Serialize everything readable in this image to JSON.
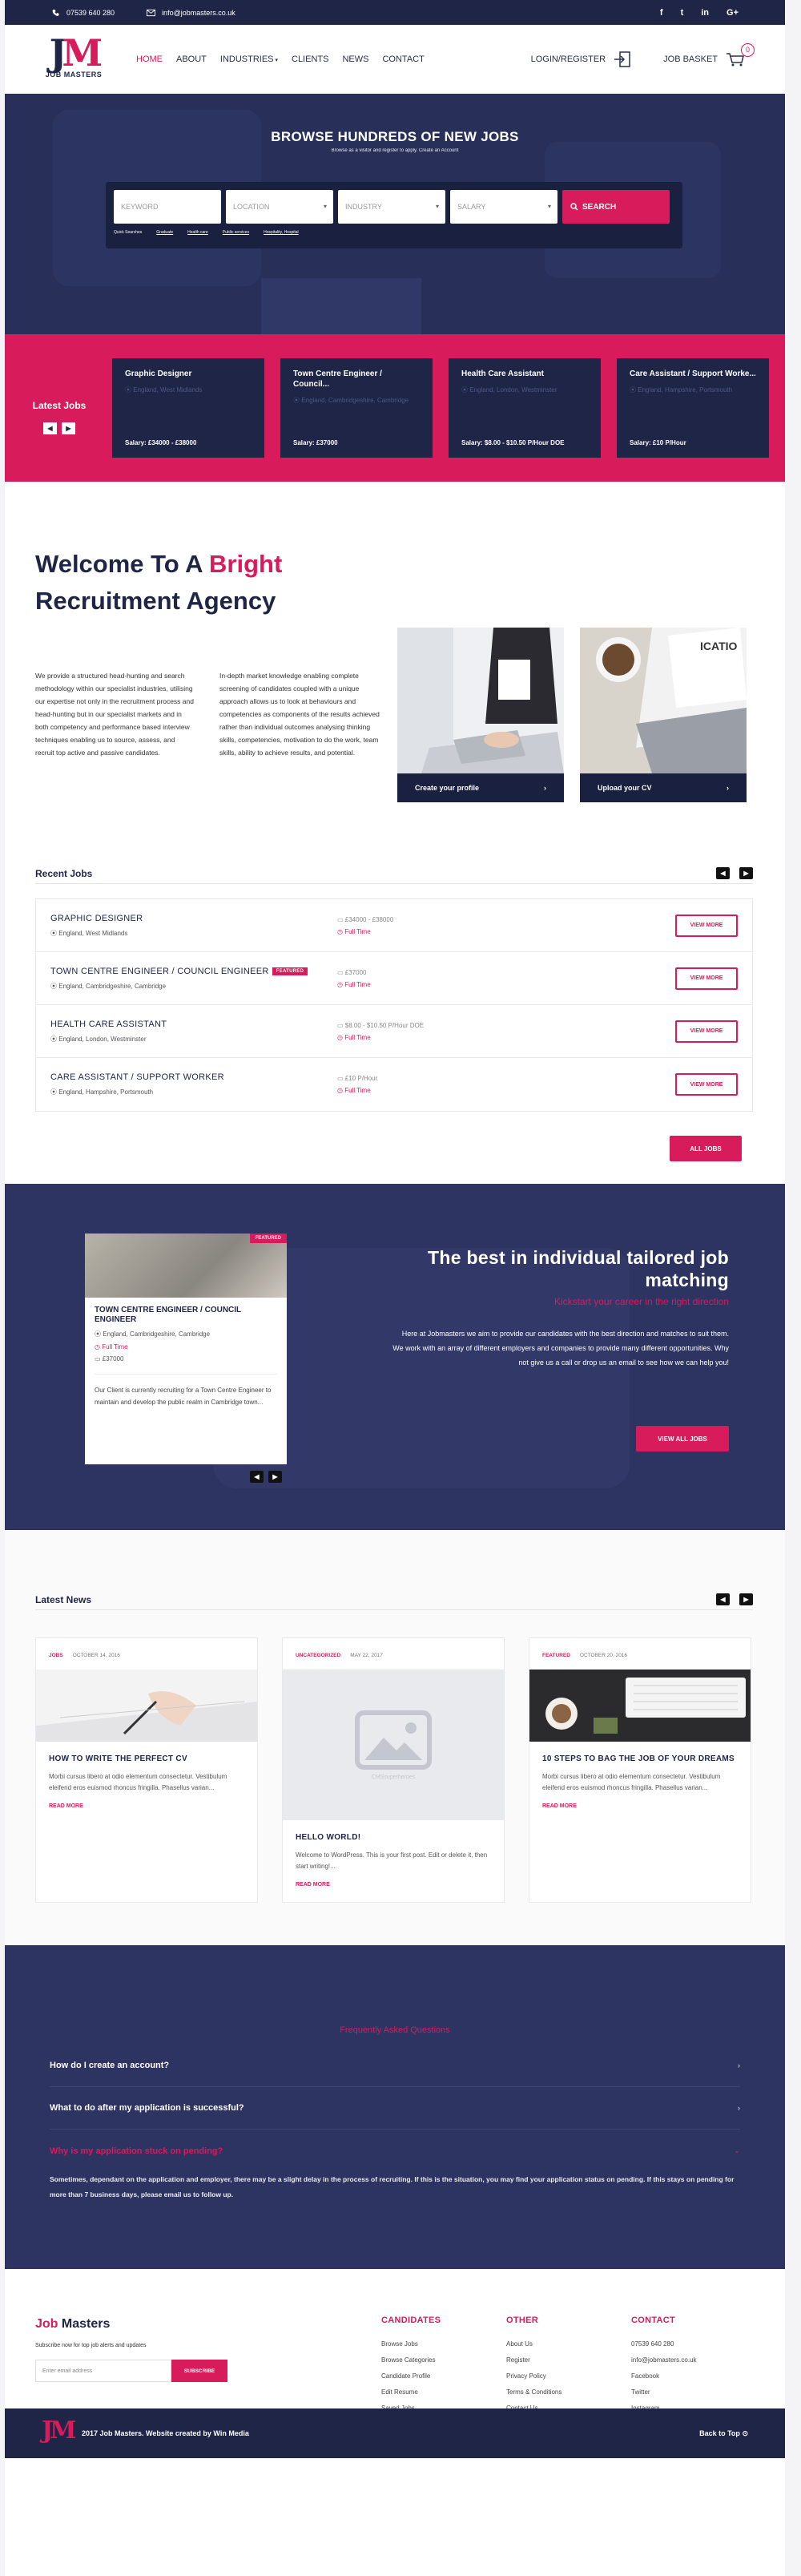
{
  "topbar": {
    "phone": "07539 640 280",
    "email": "info@jobmasters.co.uk",
    "social": [
      "f",
      "t",
      "in",
      "G+"
    ]
  },
  "brand": {
    "mark_j": "J",
    "mark_m": "M",
    "name": "JOB MASTERS"
  },
  "nav": {
    "items": [
      "HOME",
      "ABOUT",
      "INDUSTRIES",
      "CLIENTS",
      "NEWS",
      "CONTACT"
    ],
    "login": "LOGIN/REGISTER",
    "basket": "JOB BASKET",
    "basket_count": "0"
  },
  "hero": {
    "title": "BROWSE HUNDREDS OF NEW JOBS",
    "subtitle": "Browse as a visitor and register to apply. Create an Account",
    "fields": {
      "keyword": "KEYWORD",
      "location": "LOCATION",
      "industry": "INDUSTRY",
      "salary": "SALARY"
    },
    "search_label": "SEARCH",
    "quick": [
      "Quick Searches",
      "Graduate",
      "Health care",
      "Public services",
      "Hospitality, Hospital"
    ]
  },
  "latest_jobs": {
    "label": "Latest Jobs",
    "cards": [
      {
        "title": "Graphic Designer",
        "location": "England, West Midlands",
        "salary": "Salary: £34000 - £38000"
      },
      {
        "title": "Town Centre Engineer / Council...",
        "location": "England, Cambridgeshire, Cambridge",
        "salary": "Salary: £37000"
      },
      {
        "title": "Health Care Assistant",
        "location": "England, London, Westminster",
        "salary": "Salary: $8.00 - $10.50 P/Hour DOE"
      },
      {
        "title": "Care Assistant / Support Worke...",
        "location": "England, Hampshire, Portsmouth",
        "salary": "Salary: £10 P/Hour"
      }
    ]
  },
  "welcome": {
    "line1": "Welcome To A ",
    "bright": "Bright",
    "line2": "Recruitment Agency",
    "p1": "We provide a structured head-hunting and search methodology within our specialist industries, utilising our expertise not only in the recruitment process and head-hunting but in our specialist markets and in both competency and performance based interview techniques enabling us to source, assess, and recruit top active and passive candidates.",
    "p2": "In-depth market knowledge enabling complete screening of candidates coupled with a unique approach allows us to look at behaviours and competencies as components of the results achieved rather than individual outcomes analysing thinking skills, competencies, motivation to do the work, team skills, ability to achieve results, and potential.",
    "cards": [
      {
        "label": "Create your profile"
      },
      {
        "label": "Upload your CV"
      }
    ]
  },
  "recent": {
    "title": "Recent Jobs",
    "view_more": "VIEW MORE",
    "all_jobs": "ALL JOBS",
    "featured": "FEATURED",
    "jobs": [
      {
        "title": "GRAPHIC DESIGNER",
        "location": "England, West Midlands",
        "salary": "£34000 - £38000",
        "type": "Full Time"
      },
      {
        "title": "TOWN CENTRE ENGINEER / COUNCIL ENGINEER",
        "location": "England, Cambridgeshire, Cambridge",
        "salary": "£37000",
        "type": "Full Time"
      },
      {
        "title": "HEALTH CARE ASSISTANT",
        "location": "England, London, Westminster",
        "salary": "$8.00 - $10.50 P/Hour DOE",
        "type": "Full Time"
      },
      {
        "title": "CARE ASSISTANT / SUPPORT WORKER",
        "location": "England, Hampshire, Portsmouth",
        "salary": "£10 P/Hour",
        "type": "Full Time"
      }
    ]
  },
  "tailored": {
    "card": {
      "badge": "FEATURED",
      "title": "TOWN CENTRE ENGINEER / COUNCIL ENGINEER",
      "location": "England, Cambridgeshire, Cambridge",
      "type": "Full Time",
      "salary": "£37000",
      "desc": "Our Client is currently recruiting for a Town Centre Engineer to maintain and develop the public realm in Cambridge town..."
    },
    "title": "The best in individual tailored job matching",
    "subtitle": "Kickstart your career in the right direction",
    "body": "Here at Jobmasters we aim to provide our candidates with the best direction and matches to suit them. We work with an array of different employers and companies to provide many different opportunities. Why not give us a call or drop us an email to see how we can help you!",
    "cta": "VIEW ALL JOBS"
  },
  "news": {
    "title": "Latest News",
    "read_more": "READ MORE",
    "items": [
      {
        "cat": "JOBS",
        "date": "OCTOBER 14, 2016",
        "title": "HOW TO WRITE THE PERFECT CV",
        "excerpt": "Morbi cursus libero at odio elementum consectetur. Vestibulum eleifend eros euismod rhoncus fringilla. Phasellus varian..."
      },
      {
        "cat": "UNCATEGORIZED",
        "date": "MAY 22, 2017",
        "title": "HELLO WORLD!",
        "excerpt": "Welcome to WordPress. This is your first post. Edit or delete it, then start writing!...",
        "placeholder": "CMSsuperheroes"
      },
      {
        "cat": "FEATURED",
        "date": "OCTOBER 20, 2016",
        "title": "10 STEPS TO BAG THE JOB OF YOUR DREAMS",
        "excerpt": "Morbi cursus libero at odio elementum consectetur. Vestibulum eleifend eros euismod rhoncus fringilla. Phasellus varian..."
      }
    ]
  },
  "faq": {
    "title": "Frequently Asked Questions",
    "q1": "How do I create an account?",
    "q2": "What to do after my application is successful?",
    "q3": "Why is my application stuck on pending?",
    "a3": "Sometimes, dependant on the application and employer, there may be a slight delay in the process of recruiting. If this is the situation, you may find your application status on pending. If this stays on pending for more than 7 business days, please email us to follow up."
  },
  "footer": {
    "brand_j": "Job",
    "brand_rest": " Masters",
    "subscribe_text": "Subscribe now for top job alerts and updates",
    "email_placeholder": "Enter email address",
    "subscribe_btn": "SUBSCRIBE",
    "cols": [
      {
        "title": "CANDIDATES",
        "links": [
          "Browse Jobs",
          "Browse Categories",
          "Candidate Profile",
          "Edit Resume",
          "Saved Jobs"
        ]
      },
      {
        "title": "OTHER",
        "links": [
          "About Us",
          "Register",
          "Privacy Policy",
          "Terms & Conditions",
          "Contact Us"
        ]
      },
      {
        "title": "CONTACT",
        "links": [
          "07539 640 280",
          "info@jobmasters.co.uk",
          "Facebook",
          "Twitter",
          "Instagram"
        ]
      }
    ],
    "copyright": "2017 Job Masters. Website created by Win Media",
    "back_to_top": "Back to Top"
  },
  "colors": {
    "navy": "#1e2547",
    "accent": "#d81b5a"
  }
}
